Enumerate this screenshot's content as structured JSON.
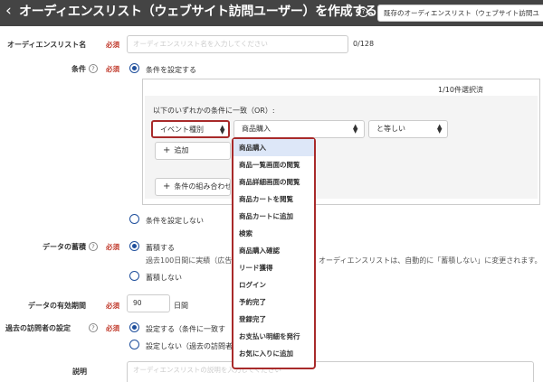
{
  "header": {
    "back_icon": "chevron-left-icon",
    "title": "オーディエンスリスト（ウェブサイト訪問ユーザー）を作成する",
    "existing_select": "既存のオーディエンスリスト（ウェブサイト訪問ユ"
  },
  "required_label": "必須",
  "form": {
    "name": {
      "label": "オーディエンスリスト名",
      "placeholder": "オーディエンスリスト名を入力してください",
      "counter": "0/128"
    },
    "conditions": {
      "label": "条件",
      "option_set": "条件を設定する",
      "option_none": "条件を設定しない",
      "selected_count": "1/10件選択済",
      "match_text": "以下のいずれかの条件に一致（OR）:",
      "field_select": "イベント種別",
      "value_select": "商品購入",
      "operator_select": "と等しい",
      "add_button": "追加",
      "add_group_button": "条件の組み合わせを"
    },
    "accumulate": {
      "label": "データの蓄積",
      "option_yes": "蓄積する",
      "note": "過去100日間に実績（広告",
      "note_tail": "オーディエンスリストは、自動的に「蓄積しない」に変更されます。",
      "option_no": "蓄積しない"
    },
    "validity": {
      "label": "データの有効期間",
      "value": "90",
      "unit": "日間"
    },
    "past_visitors": {
      "label": "過去の訪問者の設定",
      "option_yes": "設定する（条件に一致す",
      "option_no": "設定しない（過去の訪問者"
    },
    "description": {
      "label": "説明",
      "placeholder": "オーディエンスリストの説明を入力してください"
    }
  },
  "dropdown": {
    "items": [
      "商品購入",
      "商品一覧画面の閲覧",
      "商品詳細画面の閲覧",
      "商品カートを閲覧",
      "商品カートに追加",
      "検索",
      "商品購入確認",
      "リード獲得",
      "ログイン",
      "予約完了",
      "登録完了",
      "お支払い明細を発行",
      "お気に入りに追加"
    ],
    "selected": "商品購入"
  },
  "colors": {
    "header_bg": "#444444",
    "required": "#c0392b",
    "radio": "#1f4f9c",
    "highlight_border": "#a82a2a",
    "dropdown_active": "#dde7f8"
  }
}
